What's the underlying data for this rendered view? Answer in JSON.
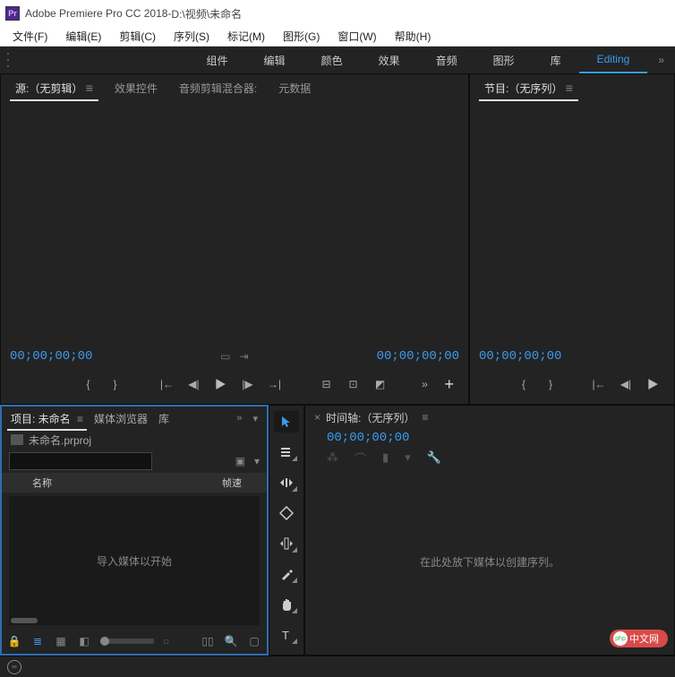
{
  "titlebar": {
    "app_name": "Adobe Premiere Pro CC 2018",
    "separator": " - ",
    "file_path": "D:\\视频\\未命名"
  },
  "menubar": {
    "items": [
      "文件(F)",
      "编辑(E)",
      "剪辑(C)",
      "序列(S)",
      "标记(M)",
      "图形(G)",
      "窗口(W)",
      "帮助(H)"
    ]
  },
  "workspaces": {
    "items": [
      "组件",
      "编辑",
      "颜色",
      "效果",
      "音频",
      "图形",
      "库",
      "Editing"
    ],
    "active_index": 7
  },
  "source_panel": {
    "tabs": [
      "源:（无剪辑）",
      "效果控件",
      "音频剪辑混合器:",
      "元数据"
    ],
    "active_tab": 0,
    "tc_left": "00;00;00;00",
    "tc_right": "00;00;00;00"
  },
  "program_panel": {
    "title": "节目:（无序列）",
    "tc": "00;00;00;00"
  },
  "project_panel": {
    "tabs": [
      "项目: 未命名",
      "媒体浏览器",
      "库"
    ],
    "active_tab": 0,
    "project_file": "未命名.prproj",
    "search_placeholder": "",
    "col_name": "名称",
    "col_rate": "帧速",
    "empty_hint": "导入媒体以开始"
  },
  "timeline_panel": {
    "title": "时间轴:（无序列）",
    "tc": "00;00;00;00",
    "empty_hint": "在此处放下媒体以创建序列。"
  },
  "tools": {
    "names": [
      "selection-tool",
      "track-select-tool",
      "ripple-edit-tool",
      "razor-tool",
      "slip-tool",
      "pen-tool",
      "hand-tool",
      "type-tool"
    ]
  },
  "watermark": {
    "text": "中文网"
  }
}
